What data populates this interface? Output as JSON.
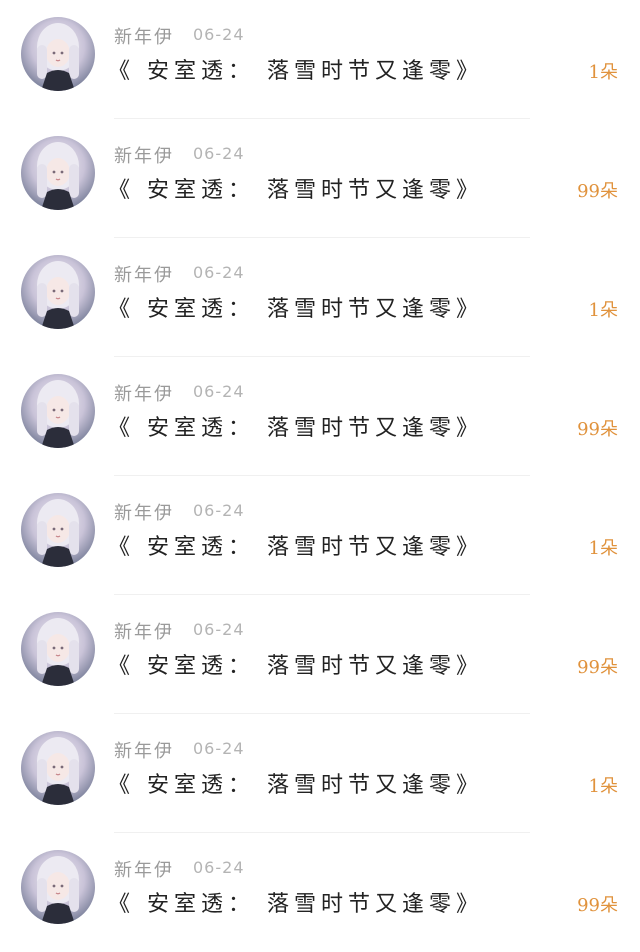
{
  "rows": [
    {
      "name": "新年伊",
      "date": "06-24",
      "title": "《 安室透： 落雪时节又逢零》",
      "count": "1朵"
    },
    {
      "name": "新年伊",
      "date": "06-24",
      "title": "《 安室透： 落雪时节又逢零》",
      "count": "99朵"
    },
    {
      "name": "新年伊",
      "date": "06-24",
      "title": "《 安室透： 落雪时节又逢零》",
      "count": "1朵"
    },
    {
      "name": "新年伊",
      "date": "06-24",
      "title": "《 安室透： 落雪时节又逢零》",
      "count": "99朵"
    },
    {
      "name": "新年伊",
      "date": "06-24",
      "title": "《 安室透： 落雪时节又逢零》",
      "count": "1朵"
    },
    {
      "name": "新年伊",
      "date": "06-24",
      "title": "《 安室透： 落雪时节又逢零》",
      "count": "99朵"
    },
    {
      "name": "新年伊",
      "date": "06-24",
      "title": "《 安室透： 落雪时节又逢零》",
      "count": "1朵"
    },
    {
      "name": "新年伊",
      "date": "06-24",
      "title": "《 安室透： 落雪时节又逢零》",
      "count": "99朵"
    }
  ],
  "colors": {
    "name": "#9a9a9a",
    "date": "#b4b4b4",
    "title": "#222222",
    "count": "#e0923c",
    "divider": "#f0f0f0"
  },
  "icons": {
    "avatar": "user-avatar-photo"
  }
}
